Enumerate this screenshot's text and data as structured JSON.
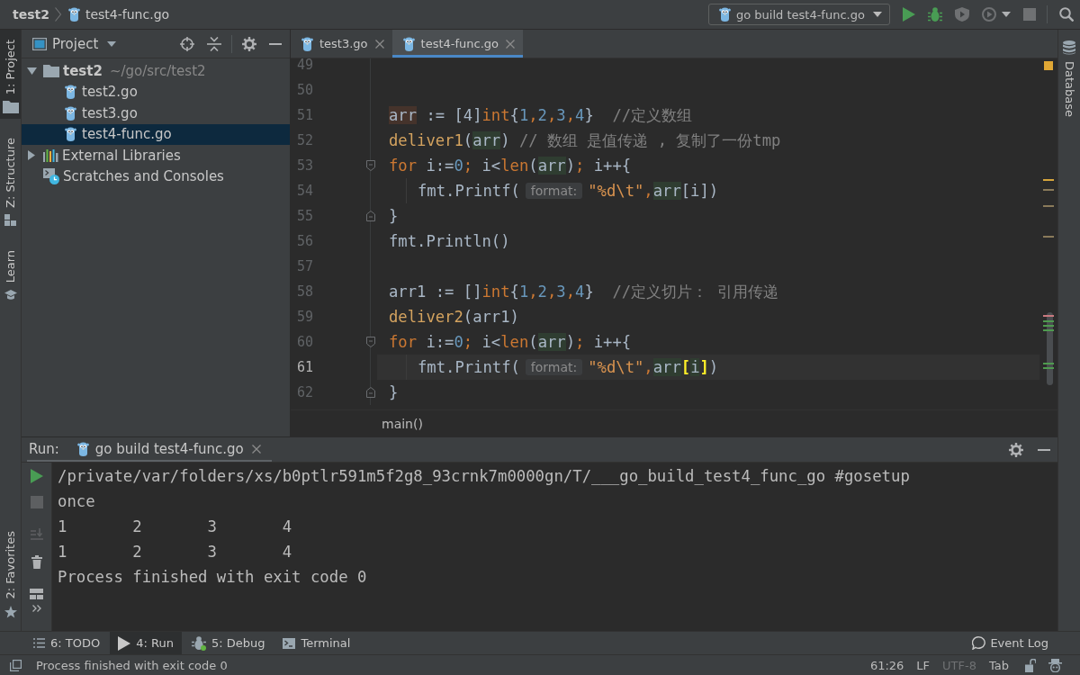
{
  "title_bar": {
    "breadcrumbs": [
      {
        "label": "test2",
        "kind": "module"
      },
      {
        "label": "test4-func.go",
        "kind": "go_file"
      }
    ],
    "run_config": {
      "label": "go build test4-func.go"
    },
    "actions": [
      {
        "kind": "run",
        "disabled": false
      },
      {
        "kind": "debug",
        "disabled": false
      },
      {
        "kind": "coverage",
        "disabled": true
      },
      {
        "kind": "profile",
        "disabled": true
      },
      {
        "kind": "stop",
        "disabled": true
      },
      {
        "kind": "search",
        "disabled": false
      }
    ]
  },
  "left_strip": {
    "top": [
      {
        "label": "1: Project",
        "kind": "project",
        "selected": true
      },
      {
        "label": "Z: Structure",
        "kind": "structure",
        "selected": false
      },
      {
        "label": "Learn",
        "kind": "learn",
        "selected": false
      }
    ],
    "bottom": [
      {
        "label": "2: Favorites",
        "kind": "favorites",
        "selected": false
      }
    ]
  },
  "project_panel": {
    "title": "Project",
    "tree": [
      {
        "label": "test2",
        "path": "~/go/src/test2",
        "kind": "module",
        "expanded": true,
        "selected": false,
        "children": [
          {
            "label": "test2.go",
            "kind": "go_file",
            "selected": false
          },
          {
            "label": "test3.go",
            "kind": "go_file",
            "selected": false
          },
          {
            "label": "test4-func.go",
            "kind": "go_file",
            "selected": true
          }
        ]
      },
      {
        "label": "External Libraries",
        "kind": "libraries",
        "expanded": false,
        "selected": false
      },
      {
        "label": "Scratches and Consoles",
        "kind": "scratches",
        "selected": false
      }
    ]
  },
  "editor": {
    "tabs": [
      {
        "label": "test3.go",
        "selected": false
      },
      {
        "label": "test4-func.go",
        "selected": true
      }
    ],
    "lines": [
      {
        "number": "49",
        "current": false
      },
      {
        "number": "50",
        "current": false
      },
      {
        "number": "51",
        "current": false,
        "tokens": [
          {
            "text": "arr",
            "kind": "write_usage"
          },
          {
            "text": " := [4]",
            "kind": "plain"
          },
          {
            "text": "int",
            "kind": "type"
          },
          {
            "text": "{",
            "kind": "plain"
          },
          {
            "text": "1",
            "kind": "number"
          },
          {
            "text": ",",
            "kind": "punctuation"
          },
          {
            "text": "2",
            "kind": "number"
          },
          {
            "text": ",",
            "kind": "punctuation"
          },
          {
            "text": "3",
            "kind": "number"
          },
          {
            "text": ",",
            "kind": "punctuation"
          },
          {
            "text": "4",
            "kind": "number"
          },
          {
            "text": "}",
            "kind": "plain"
          },
          {
            "text": "  //定义数组",
            "kind": "comment"
          }
        ]
      },
      {
        "number": "52",
        "current": false,
        "tokens": [
          {
            "text": "deliver1",
            "kind": "call"
          },
          {
            "text": "(",
            "kind": "plain"
          },
          {
            "text": "arr",
            "kind": "read_usage"
          },
          {
            "text": ")",
            "kind": "plain"
          },
          {
            "text": " // 数组 是值传递 , 复制了一份tmp",
            "kind": "comment"
          }
        ]
      },
      {
        "number": "53",
        "current": false,
        "fold": {
          "kind": "start"
        },
        "tokens": [
          {
            "text": "for",
            "kind": "keyword"
          },
          {
            "text": " i:=",
            "kind": "plain"
          },
          {
            "text": "0",
            "kind": "number"
          },
          {
            "text": ";",
            "kind": "punctuation"
          },
          {
            "text": " i<",
            "kind": "plain"
          },
          {
            "text": "len",
            "kind": "builtin"
          },
          {
            "text": "(",
            "kind": "plain"
          },
          {
            "text": "arr",
            "kind": "read_usage"
          },
          {
            "text": ")",
            "kind": "plain"
          },
          {
            "text": ";",
            "kind": "punctuation"
          },
          {
            "text": " i++{",
            "kind": "plain"
          }
        ]
      },
      {
        "number": "54",
        "current": false,
        "tokens": [
          {
            "kind": "indent"
          },
          {
            "text": "fmt.Printf(",
            "kind": "plain"
          },
          {
            "text": "format:",
            "kind": "hint"
          },
          {
            "text": "\"%d\\t\"",
            "kind": "string"
          },
          {
            "text": ",",
            "kind": "punctuation"
          },
          {
            "text": "arr",
            "kind": "read_usage"
          },
          {
            "text": "[i])",
            "kind": "plain"
          }
        ]
      },
      {
        "number": "55",
        "current": false,
        "fold": {
          "kind": "end"
        },
        "tokens": [
          {
            "text": "}",
            "kind": "plain"
          }
        ]
      },
      {
        "number": "56",
        "current": false,
        "tokens": [
          {
            "text": "fmt.Println()",
            "kind": "plain"
          }
        ]
      },
      {
        "number": "57",
        "current": false
      },
      {
        "number": "58",
        "current": false,
        "tokens": [
          {
            "text": "arr1 := []",
            "kind": "plain"
          },
          {
            "text": "int",
            "kind": "type"
          },
          {
            "text": "{",
            "kind": "plain"
          },
          {
            "text": "1",
            "kind": "number"
          },
          {
            "text": ",",
            "kind": "punctuation"
          },
          {
            "text": "2",
            "kind": "number"
          },
          {
            "text": ",",
            "kind": "punctuation"
          },
          {
            "text": "3",
            "kind": "number"
          },
          {
            "text": ",",
            "kind": "punctuation"
          },
          {
            "text": "4",
            "kind": "number"
          },
          {
            "text": "}",
            "kind": "plain"
          },
          {
            "text": "  //定义切片： 引用传递",
            "kind": "comment"
          }
        ]
      },
      {
        "number": "59",
        "current": false,
        "tokens": [
          {
            "text": "deliver2",
            "kind": "call"
          },
          {
            "text": "(arr1)",
            "kind": "plain"
          }
        ]
      },
      {
        "number": "60",
        "current": false,
        "fold": {
          "kind": "start"
        },
        "tokens": [
          {
            "text": "for",
            "kind": "keyword"
          },
          {
            "text": " i:=",
            "kind": "plain"
          },
          {
            "text": "0",
            "kind": "number"
          },
          {
            "text": ";",
            "kind": "punctuation"
          },
          {
            "text": " i<",
            "kind": "plain"
          },
          {
            "text": "len",
            "kind": "builtin"
          },
          {
            "text": "(",
            "kind": "plain"
          },
          {
            "text": "arr",
            "kind": "read_usage"
          },
          {
            "text": ")",
            "kind": "plain"
          },
          {
            "text": ";",
            "kind": "punctuation"
          },
          {
            "text": " i++{",
            "kind": "plain"
          }
        ]
      },
      {
        "number": "61",
        "current": true,
        "tokens": [
          {
            "kind": "indent"
          },
          {
            "text": "fmt.Printf(",
            "kind": "plain"
          },
          {
            "text": "format:",
            "kind": "hint"
          },
          {
            "text": "\"%d\\t\"",
            "kind": "string"
          },
          {
            "text": ",",
            "kind": "punctuation"
          },
          {
            "text": "arr",
            "kind": "read_usage"
          },
          {
            "text": "[",
            "kind": "brace_match"
          },
          {
            "text": "i",
            "kind": "read_usage"
          },
          {
            "text": "]",
            "kind": "brace_match"
          },
          {
            "text": ")",
            "kind": "plain"
          }
        ]
      },
      {
        "number": "62",
        "current": false,
        "fold": {
          "kind": "end"
        },
        "tokens": [
          {
            "text": "}",
            "kind": "plain"
          }
        ]
      }
    ],
    "breadcrumb": "main()"
  },
  "right_strip": [
    {
      "label": "Database",
      "kind": "database",
      "selected": false
    }
  ],
  "run_panel": {
    "label": "Run:",
    "tab": "go build test4-func.go",
    "tools": [
      {
        "kind": "rerun",
        "disabled": false
      },
      {
        "kind": "stop",
        "disabled": true
      },
      {
        "kind": "scroll_to_end",
        "disabled": true
      },
      {
        "kind": "clear",
        "disabled": false
      },
      {
        "kind": "layout",
        "disabled": false
      },
      {
        "kind": "more",
        "disabled": false
      }
    ],
    "output": [
      "/private/var/folders/xs/b0ptlr591m5f2g8_93crnk7m0000gn/T/___go_build_test4_func_go #gosetup",
      "once",
      "1\t2\t3\t4",
      "1\t2\t3\t4",
      "Process finished with exit code 0"
    ]
  },
  "tool_tabs": {
    "tabs": [
      {
        "label": "6: TODO",
        "kind": "todo",
        "selected": false
      },
      {
        "label": "4: Run",
        "kind": "run",
        "selected": true
      },
      {
        "label": "5: Debug",
        "kind": "debug",
        "selected": false
      },
      {
        "label": "Terminal",
        "kind": "terminal",
        "selected": false
      }
    ],
    "event_log": "Event Log"
  },
  "status_bar": {
    "message": "Process finished with exit code 0",
    "items": [
      {
        "label": "61:26",
        "disabled": false
      },
      {
        "label": "LF",
        "disabled": false
      },
      {
        "label": "UTF-8",
        "disabled": true
      },
      {
        "label": "Tab",
        "disabled": false
      }
    ]
  }
}
